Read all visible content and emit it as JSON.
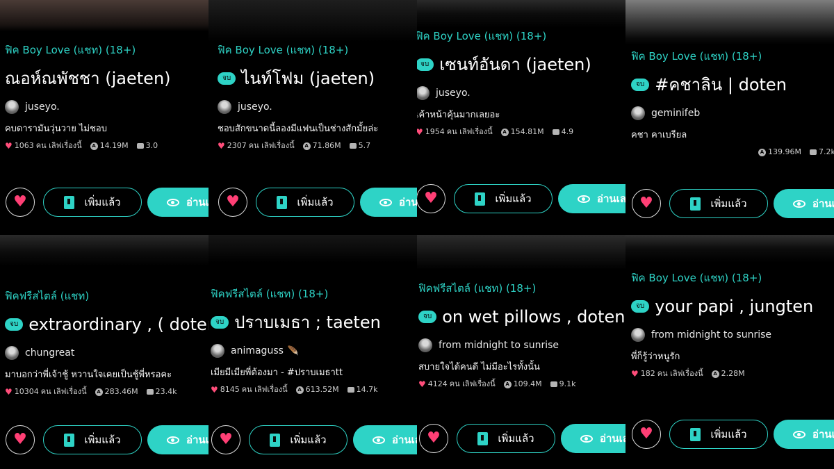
{
  "labels": {
    "added": "เพิ่มแล้ว",
    "read": "อ่านเลย",
    "read_cut": "อ่าน",
    "finished_badge": "จบ",
    "loved_suffix": "คน เลิฟเรื่องนี้"
  },
  "colors": {
    "accent": "#2ed3c6",
    "heart": "#ff3f75",
    "background": "#000000"
  },
  "cards": [
    {
      "genre": "ฟิค Boy Love (แชท) (18+)",
      "finished": false,
      "title": "ณอห์ณพัชชา (jaeten)",
      "author": "juseyo.",
      "avatar_icon": "avatar-icon",
      "description": "คบดารามันวุ่นวาย ไม่ชอบ",
      "loves": "1063",
      "views": "14.19M",
      "comments": "3.0"
    },
    {
      "genre": "ฟิค Boy Love (แชท) (18+)",
      "finished": true,
      "title": "ไนท์โฟม (jaeten)",
      "author": "juseyo.",
      "avatar_icon": "avatar-icon",
      "description": "ชอบสักขนาดนี้ลองมีแฟนเป็นช่างสักมั้ยล่ะ",
      "loves": "2307",
      "views": "71.86M",
      "comments": "5.7"
    },
    {
      "genre": "ฟิค Boy Love (แชท) (18+)",
      "finished": true,
      "title": "เซนท์อันดา (jaeten)",
      "author": "juseyo.",
      "avatar_icon": "avatar-icon",
      "description": "เค้าหน้าคุ้นมากเลยอะ",
      "loves": "1954",
      "views": "154.81M",
      "comments": "4.9"
    },
    {
      "genre": "ฟิค Boy Love (แชท) (18+)",
      "finished": true,
      "title": "#คชาลิน | doten",
      "author": "geminifeb",
      "avatar_icon": "avatar-icon",
      "description": "คชา คาเบรียล",
      "loves": "",
      "views": "139.96M",
      "comments": "7.2k"
    },
    {
      "genre": "ฟิคฟรีสไตล์ (แชท)",
      "finished": true,
      "title": "extraordinary , ( doten",
      "author": "chungreat",
      "avatar_icon": "avatar-icon",
      "description": "มาบอกว่าพี่เจ้าชู้ หวานใจเคยเป็นชู้พี่หรอคะ",
      "loves": "10304",
      "views": "283.46M",
      "comments": "23.4k"
    },
    {
      "genre": "ฟิคฟรีสไตล์ (แชท) (18+)",
      "finished": true,
      "title": "ปราบเมธา ; taeten",
      "author": "animaguss",
      "avatar_icon": "avatar-icon",
      "feather_icon": "🪶",
      "description": "เมียมีเมียพี่ต้องมา - #ปราบเมธาtt",
      "loves": "8145",
      "views": "613.52M",
      "comments": "14.7k"
    },
    {
      "genre": "ฟิคฟรีสไตล์ (แชท) (18+)",
      "finished": true,
      "title": "on wet pillows , doten",
      "author": "from midnight to sunrise",
      "avatar_icon": "avatar-icon",
      "description": "สบายใจได้คนดี ไม่มีอะไรทั้งนั้น",
      "loves": "4124",
      "views": "109.4M",
      "comments": "9.1k"
    },
    {
      "genre": "ฟิค Boy Love (แชท) (18+)",
      "finished": true,
      "title": "your papi , jungten",
      "author": "from midnight to sunrise",
      "avatar_icon": "avatar-icon",
      "description": "พี่ก็รู้ว่าหนูรัก",
      "loves": "182",
      "views": "2.28M",
      "comments": ""
    }
  ]
}
